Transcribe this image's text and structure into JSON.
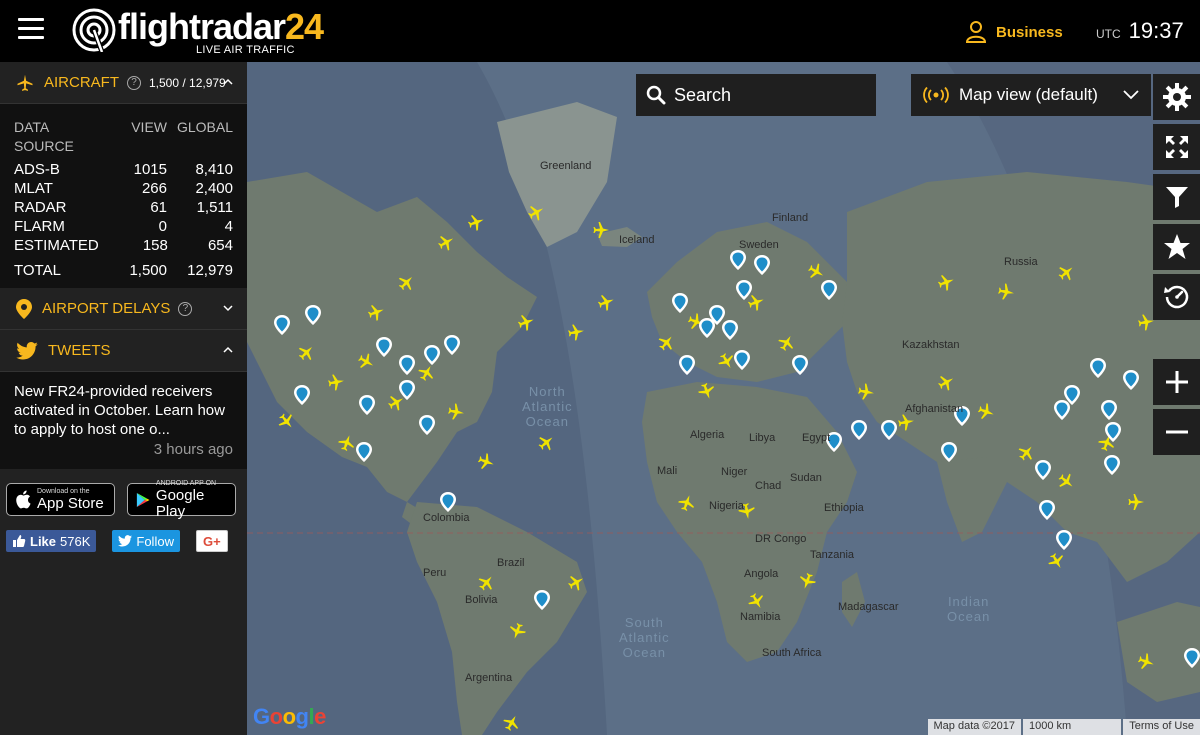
{
  "header": {
    "logo_word": "flightradar",
    "logo_num": "24",
    "logo_sub": "LIVE AIR TRAFFIC",
    "business_label": "Business",
    "utc_label": "UTC",
    "utc_time": "19:37"
  },
  "aircraft": {
    "title": "AIRCRAFT",
    "count": "1,500 / 12,979",
    "headers": [
      "DATA SOURCE",
      "VIEW",
      "GLOBAL"
    ],
    "rows": [
      {
        "source": "ADS-B",
        "view": "1015",
        "global": "8,410"
      },
      {
        "source": "MLAT",
        "view": "266",
        "global": "2,400"
      },
      {
        "source": "RADAR",
        "view": "61",
        "global": "1,511"
      },
      {
        "source": "FLARM",
        "view": "0",
        "global": "4"
      },
      {
        "source": "ESTIMATED",
        "view": "158",
        "global": "654"
      }
    ],
    "total": {
      "source": "TOTAL",
      "view": "1,500",
      "global": "12,979"
    }
  },
  "airport_delays": {
    "title": "AIRPORT DELAYS"
  },
  "tweets": {
    "title": "TWEETS",
    "text": "New FR24-provided receivers activated in October. Learn how to apply to host one o...",
    "ago": "3 hours ago"
  },
  "stores": {
    "appstore_small": "Download on the",
    "appstore_big": "App Store",
    "googleplay_small": "ANDROID APP ON",
    "googleplay_big": "Google Play"
  },
  "social": {
    "like_label": "Like",
    "like_count": "576K",
    "follow_label": "Follow",
    "gplus_label": "G+"
  },
  "map": {
    "search_label": "Search",
    "view_label": "Map view (default)",
    "labels": {
      "greenland": "Greenland",
      "iceland": "Iceland",
      "finland": "Finland",
      "sweden": "Sweden",
      "russia": "Russia",
      "kazakhstan": "Kazakhstan",
      "afghanistan": "Afghanistan",
      "algeria": "Algeria",
      "libya": "Libya",
      "egypt": "Egypt",
      "mali": "Mali",
      "niger": "Niger",
      "chad": "Chad",
      "sudan": "Sudan",
      "nigeria": "Nigeria",
      "ethiopia": "Ethiopia",
      "drcongo": "DR Congo",
      "tanzania": "Tanzania",
      "angola": "Angola",
      "namibia": "Namibia",
      "madagascar": "Madagascar",
      "southafrica": "South Africa",
      "colombia": "Colombia",
      "peru": "Peru",
      "brazil": "Brazil",
      "bolivia": "Bolivia",
      "argentina": "Argentina"
    },
    "oceans": {
      "north_atlantic": "North\nAtlantic\nOcean",
      "south_atlantic": "South\nAtlantic\nOcean",
      "indian": "Indian\nOcean"
    },
    "google": "Google",
    "attribution": [
      "Map data ©2017",
      "1000 km",
      "Terms of Use"
    ]
  },
  "colors": {
    "accent": "#f8b81e",
    "plane": "#f1e300",
    "panel": "#222222",
    "map_water": "#5c6f87",
    "map_land": "#6f7a6f"
  }
}
